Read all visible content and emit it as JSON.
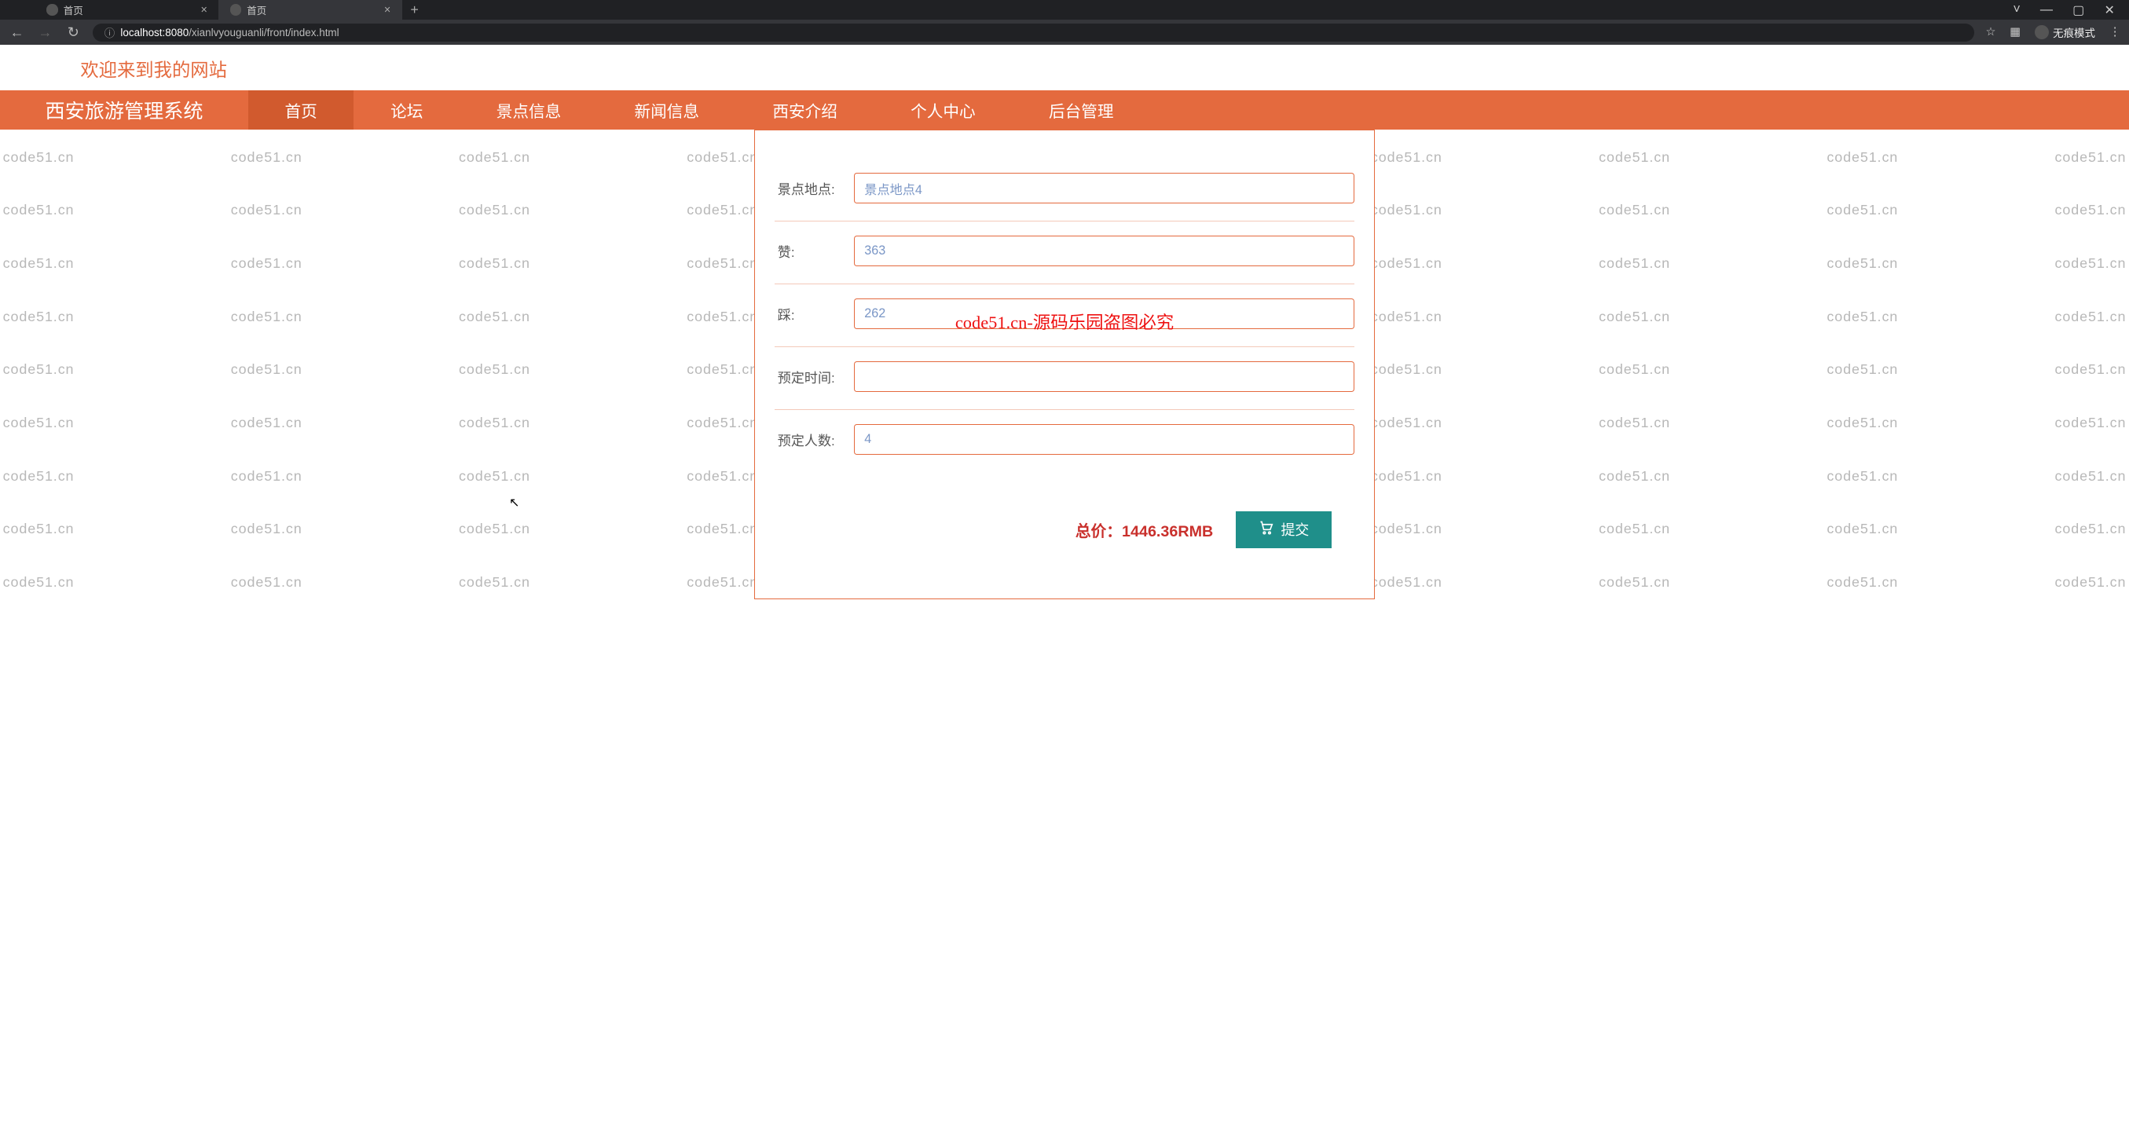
{
  "browser": {
    "tabs": [
      {
        "title": "首页"
      },
      {
        "title": "首页"
      }
    ],
    "url_prefix": "localhost:8080",
    "url_path": "/xianlvyouguanli/front/index.html",
    "incognito_label": "无痕模式",
    "window_controls": {
      "min": "—",
      "max": "▢",
      "close": "✕",
      "dropdown": "˅"
    }
  },
  "page": {
    "welcome": "欢迎来到我的网站",
    "brand": "西安旅游管理系统",
    "nav": [
      "首页",
      "论坛",
      "景点信息",
      "新闻信息",
      "西安介绍",
      "个人中心",
      "后台管理"
    ],
    "nav_active_index": 0,
    "watermark_text": "code51.cn",
    "overlay_text": "code51.cn-源码乐园盗图必究"
  },
  "form": {
    "fields": [
      {
        "label": "景点地点:",
        "value": "景点地点4"
      },
      {
        "label": "赞:",
        "value": "363"
      },
      {
        "label": "踩:",
        "value": "262"
      },
      {
        "label": "预定时间:",
        "value": ""
      },
      {
        "label": "预定人数:",
        "value": "4"
      }
    ],
    "total_label": "总价：",
    "total_value": "1446.36RMB",
    "submit_label": "提交"
  }
}
